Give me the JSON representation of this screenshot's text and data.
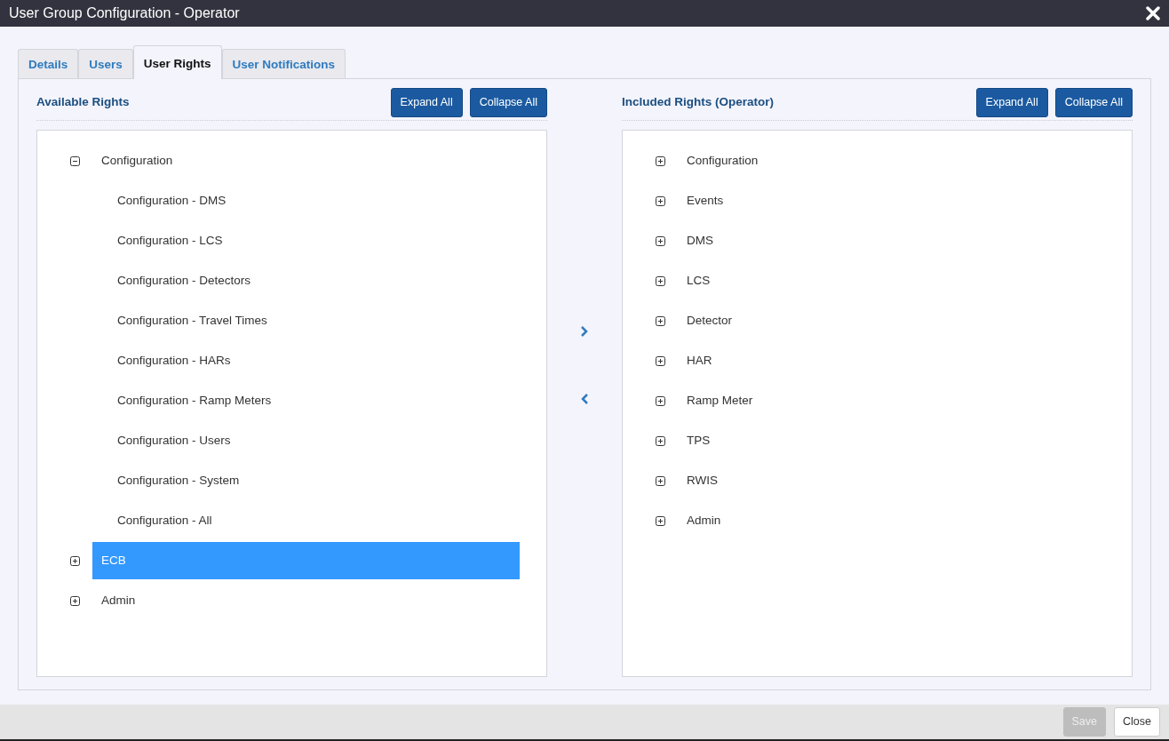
{
  "window": {
    "title": "User Group Configuration - Operator"
  },
  "tabs": [
    {
      "label": "Details",
      "selected": false
    },
    {
      "label": "Users",
      "selected": false
    },
    {
      "label": "User Rights",
      "selected": true
    },
    {
      "label": "User Notifications",
      "selected": false
    }
  ],
  "panels": [
    {
      "title": "Available Rights",
      "buttons": [
        "Expand All",
        "Collapse All"
      ],
      "tree": [
        {
          "label": "Configuration",
          "expanded": true,
          "selected": false,
          "children": [
            {
              "label": "Configuration - DMS",
              "selected": false
            },
            {
              "label": "Configuration - LCS",
              "selected": false
            },
            {
              "label": "Configuration - Detectors",
              "selected": false
            },
            {
              "label": "Configuration - Travel Times",
              "selected": false
            },
            {
              "label": "Configuration - HARs",
              "selected": false
            },
            {
              "label": "Configuration - Ramp Meters",
              "selected": false
            },
            {
              "label": "Configuration - Users",
              "selected": false
            },
            {
              "label": "Configuration - System",
              "selected": false
            },
            {
              "label": "Configuration - All",
              "selected": false
            }
          ]
        },
        {
          "label": "ECB",
          "expanded": false,
          "selected": true
        },
        {
          "label": "Admin",
          "expanded": false,
          "selected": false
        }
      ]
    },
    {
      "title": "Included Rights (Operator)",
      "buttons": [
        "Expand All",
        "Collapse All"
      ],
      "tree": [
        {
          "label": "Configuration",
          "expanded": false,
          "selected": false
        },
        {
          "label": "Events",
          "expanded": false,
          "selected": false
        },
        {
          "label": "DMS",
          "expanded": false,
          "selected": false
        },
        {
          "label": "LCS",
          "expanded": false,
          "selected": false
        },
        {
          "label": "Detector",
          "expanded": false,
          "selected": false
        },
        {
          "label": "HAR",
          "expanded": false,
          "selected": false
        },
        {
          "label": "Ramp Meter",
          "expanded": false,
          "selected": false
        },
        {
          "label": "TPS",
          "expanded": false,
          "selected": false
        },
        {
          "label": "RWIS",
          "expanded": false,
          "selected": false
        },
        {
          "label": "Admin",
          "expanded": false,
          "selected": false
        }
      ]
    }
  ],
  "footer_buttons": [
    {
      "label": "Save",
      "disabled": true
    },
    {
      "label": "Close",
      "disabled": false
    }
  ]
}
